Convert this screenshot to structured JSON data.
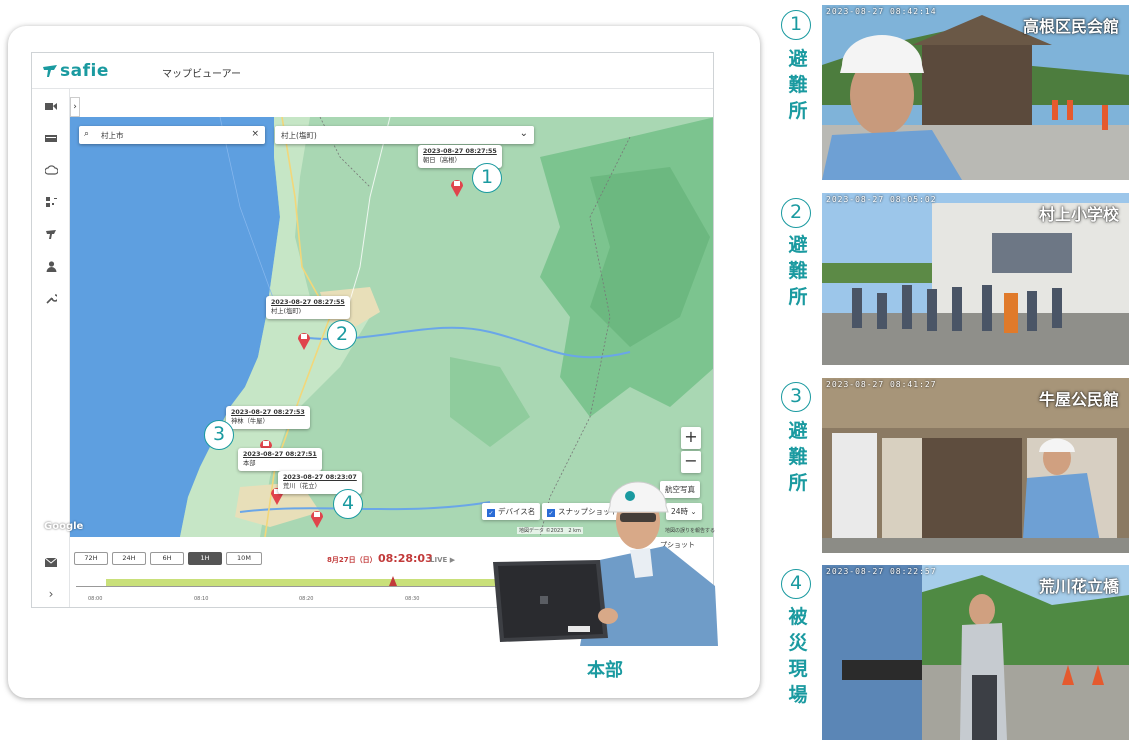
{
  "brand": {
    "logo_text": "safie",
    "app_title": "マップビューアー",
    "accent_color": "#1a9aa0",
    "live_color": "#c23a3a"
  },
  "sidebar": {
    "items": [
      {
        "icon": "camera-icon"
      },
      {
        "icon": "recorder-icon"
      },
      {
        "icon": "cloud-icon"
      },
      {
        "icon": "qr-icon"
      },
      {
        "icon": "map-icon"
      },
      {
        "icon": "user-icon"
      },
      {
        "icon": "wrench-icon"
      },
      {
        "icon": "mail-icon"
      },
      {
        "icon": "chevron-right-icon"
      }
    ]
  },
  "search": {
    "value": "村上市"
  },
  "location_select": {
    "value": "村上(塩町)"
  },
  "callouts": [
    {
      "ts": "2023-08-27 08:27:55",
      "label": "朝日（高根）",
      "num": "1"
    },
    {
      "ts": "2023-08-27 08:27:55",
      "label": "村上(塩町)",
      "num": "2"
    },
    {
      "ts": "2023-08-27 08:27:53",
      "label": "神林（牛屋）",
      "num": "3"
    },
    {
      "ts": "2023-08-27 08:27:51",
      "label": "本部",
      "num": ""
    },
    {
      "ts": "2023-08-27 08:23:07",
      "label": "荒川（花立）",
      "num": "4"
    }
  ],
  "map_controls": {
    "zoom_in": "+",
    "zoom_out": "−",
    "aerial_label": "航空写真",
    "device_name_label": "デバイス名",
    "snapshot_label": "スナップショット",
    "hours_label": "24時",
    "google": "Google",
    "attribution": "地図データ ©2023　2 km",
    "report": "地図の誤りを報告する"
  },
  "timeline": {
    "ranges": [
      "72H",
      "24H",
      "6H",
      "1H",
      "10M"
    ],
    "active_range": "1H",
    "date": "8月27日（日）",
    "time": "08:28:03",
    "live_label": "LIVE ▶",
    "ticks": [
      "08:00",
      "08:10",
      "08:20",
      "08:30"
    ],
    "snapshot_label": "プショット"
  },
  "honbu": {
    "label": "本部"
  },
  "sites": [
    {
      "num": "1",
      "vertical": [
        "避",
        "難",
        "所"
      ],
      "title": "高根区民会館",
      "timestamp": "2023-08-27 08:42:14"
    },
    {
      "num": "2",
      "vertical": [
        "避",
        "難",
        "所"
      ],
      "title": "村上小学校",
      "timestamp": "2023-08-27 08:05:02"
    },
    {
      "num": "3",
      "vertical": [
        "避",
        "難",
        "所"
      ],
      "title": "牛屋公民館",
      "timestamp": "2023-08-27 08:41:27"
    },
    {
      "num": "4",
      "vertical": [
        "被",
        "災",
        "現",
        "場"
      ],
      "title": "荒川花立橋",
      "timestamp": "2023-08-27 08:22:57"
    }
  ]
}
